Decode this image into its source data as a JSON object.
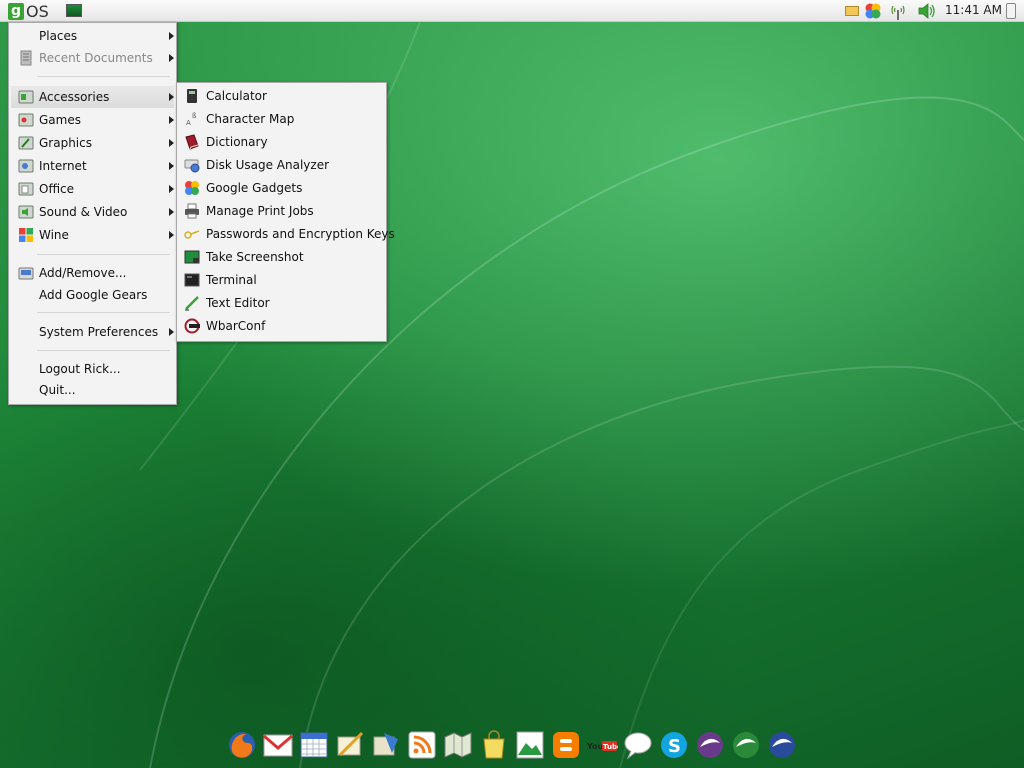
{
  "top_panel": {
    "logo_letter": "g",
    "os_label": "OS",
    "clock": "11:41 AM",
    "tray_icons": [
      "mail-icon",
      "google-gadgets-icon",
      "network-icon",
      "volume-icon",
      "battery-icon"
    ]
  },
  "main_menu": {
    "items": [
      {
        "label": "Places",
        "submenu": true
      },
      {
        "label": "Recent Documents",
        "submenu": true,
        "disabled": true
      },
      {
        "label": "Accessories",
        "submenu": true,
        "active": true
      },
      {
        "label": "Games",
        "submenu": true
      },
      {
        "label": "Graphics",
        "submenu": true
      },
      {
        "label": "Internet",
        "submenu": true
      },
      {
        "label": "Office",
        "submenu": true
      },
      {
        "label": "Sound & Video",
        "submenu": true
      },
      {
        "label": "Wine",
        "submenu": true
      },
      {
        "label": "Add/Remove..."
      },
      {
        "label": "Add Google Gears"
      },
      {
        "label": "System Preferences",
        "submenu": true
      },
      {
        "label": "Logout Rick..."
      },
      {
        "label": "Quit..."
      }
    ]
  },
  "accessories_menu": {
    "items": [
      {
        "label": "Calculator"
      },
      {
        "label": "Character Map"
      },
      {
        "label": "Dictionary"
      },
      {
        "label": "Disk Usage Analyzer"
      },
      {
        "label": "Google Gadgets"
      },
      {
        "label": "Manage Print Jobs"
      },
      {
        "label": "Passwords and Encryption Keys"
      },
      {
        "label": "Take Screenshot"
      },
      {
        "label": "Terminal"
      },
      {
        "label": "Text Editor"
      },
      {
        "label": "WbarConf"
      }
    ]
  },
  "dock": {
    "items": [
      {
        "icon": "firefox-icon"
      },
      {
        "icon": "gmail-icon"
      },
      {
        "icon": "calendar-icon"
      },
      {
        "icon": "docs-icon"
      },
      {
        "icon": "spreadsheet-icon"
      },
      {
        "icon": "rss-reader-icon"
      },
      {
        "icon": "maps-icon"
      },
      {
        "icon": "shopping-bag-icon"
      },
      {
        "icon": "picasa-icon"
      },
      {
        "icon": "blogger-icon"
      },
      {
        "icon": "youtube-icon",
        "text": "You Tube"
      },
      {
        "icon": "chat-icon"
      },
      {
        "icon": "skype-icon"
      },
      {
        "icon": "openoffice-writer-icon"
      },
      {
        "icon": "openoffice-calc-icon"
      },
      {
        "icon": "openoffice-impress-icon"
      }
    ]
  },
  "colors": {
    "desktop_green": "#1f8a3a",
    "logo_green": "#3aa335",
    "menu_bg": "#f3f3f3"
  }
}
